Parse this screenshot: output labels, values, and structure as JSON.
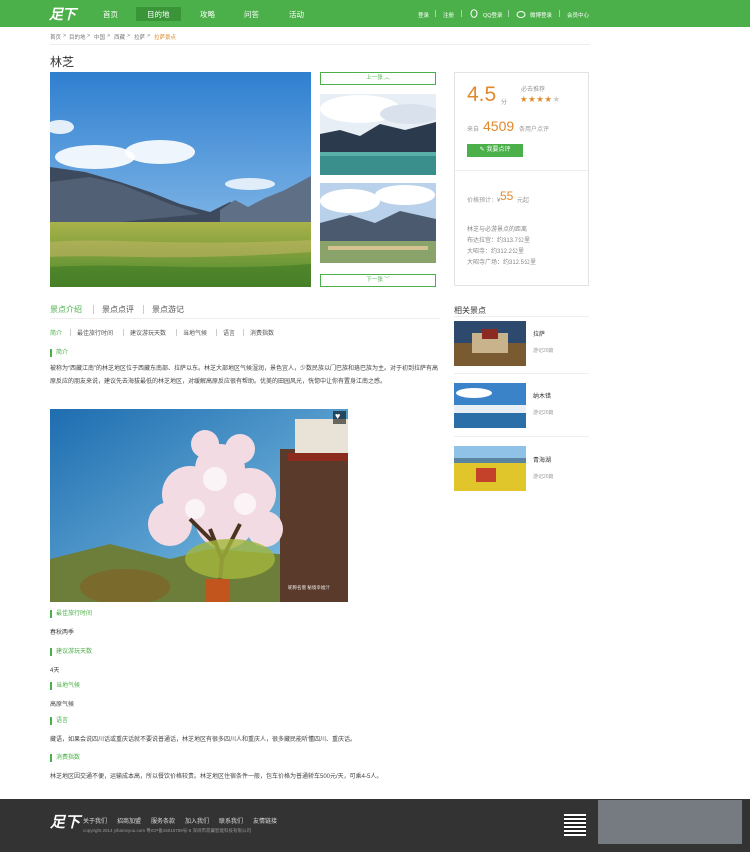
{
  "nav": {
    "logo": "足下",
    "items": [
      "首页",
      "目的地",
      "攻略",
      "问答",
      "活动"
    ],
    "active": 1,
    "right": [
      "登录",
      "注册",
      "QQ登录",
      "微博登录",
      "会员中心"
    ]
  },
  "breadcrumb": [
    "首页",
    "目的地",
    "中国",
    "西藏",
    "拉萨",
    "拉萨景点"
  ],
  "breadcrumb_seps": [
    ">",
    ">",
    ">",
    ">",
    ">"
  ],
  "title": "林芝",
  "prev_label": "上一张",
  "next_label": "下一张",
  "rating": {
    "score": "4.5",
    "unit": "分",
    "recommend_label": "必去推荐",
    "stars": "★★★★",
    "star_empty": "★",
    "from": "来自",
    "count": "4509",
    "count_suffix": "条用户点评",
    "button": "我要点评",
    "price_label": "价格预计：¥",
    "price": "55",
    "price_unit": "元起",
    "dist_title": "林芝与必游景点的距离",
    "dists": [
      "布达拉宫：约313.7公里",
      "大昭寺：约312.2公里",
      "大昭寺广场：约312.5公里"
    ]
  },
  "tabs": [
    "景点介绍",
    "景点点评",
    "景点游记"
  ],
  "subtabs": [
    "简介",
    "最佳旅行时间",
    "建议游玩天数",
    "当地气候",
    "语言",
    "消费指数"
  ],
  "intro_title": "简介",
  "intro_text": "被称为“西藏江南”的林芝地区位于西藏东南部、拉萨以东。林芝大部地区气候湿润，景色宜人，少数民族以门巴族和珞巴族为主。对于初到拉萨有高原反应的朋友来说，建议先去海拔最低的林芝地区，对缓解高原反应很有帮助。优美的田园风光，恍惚中让你有置身江南之感。",
  "photo_caption": "昵称名僧  秘境幸福汁",
  "sections": [
    {
      "title": "最佳旅行时间",
      "value": "春秋两季"
    },
    {
      "title": "建议游玩天数",
      "value": "4天"
    },
    {
      "title": "当地气候",
      "value": "高原气候"
    },
    {
      "title": "语言",
      "value": "藏语，如果会说四川话或重庆话就不要说普通话，林芝地区有很多四川人和重庆人，很多藏民能听懂四川、重庆话。"
    },
    {
      "title": "消费指数",
      "value": "林芝地区因交通不便，运输成本高，所以餐饮价格较贵。林芝地区住宿条件一般，包车价格为普通轿车500元/天，可乘4-5人。"
    }
  ],
  "related": {
    "title": "相关景点",
    "items": [
      {
        "name": "拉萨",
        "sub": "游记20篇"
      },
      {
        "name": "纳木错",
        "sub": "游记20篇"
      },
      {
        "name": "青海湖",
        "sub": "游记20篇"
      }
    ]
  },
  "footer": {
    "logo": "足下",
    "links": [
      "关于我们",
      "招商加盟",
      "服务条款",
      "加入我们",
      "联系我们",
      "友情链接"
    ],
    "copyright": "copyright 2014 yihanIvyou.com    粤ICP备15015759号-5  深圳市昂翼智能科技有限公司"
  },
  "colors": {
    "brand": "#4cb04a",
    "accent": "#e08a2c",
    "footer": "#333333"
  }
}
